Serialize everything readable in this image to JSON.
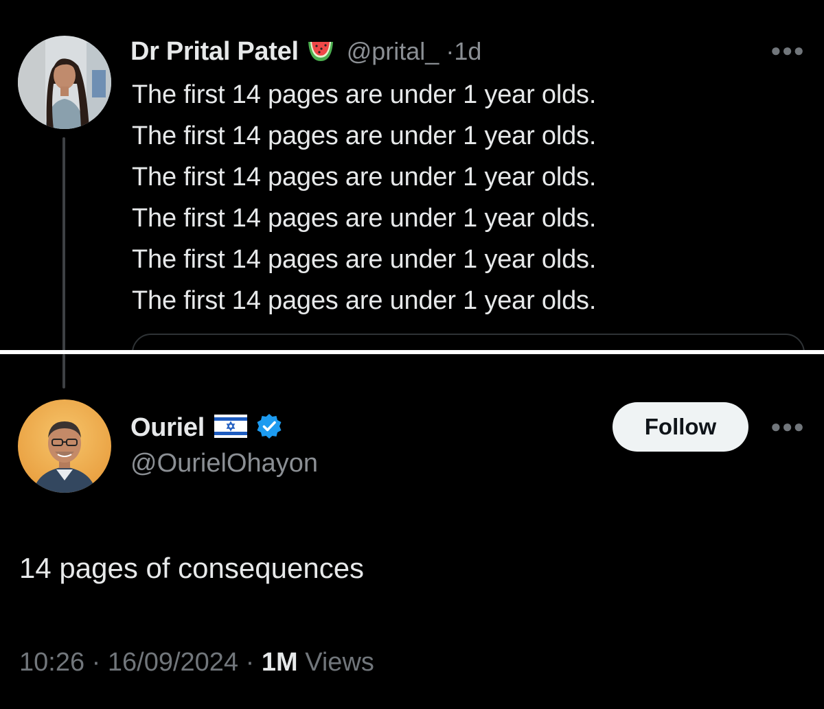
{
  "top_tweet": {
    "display_name": "Dr Prital Patel",
    "name_emoji": "watermelon-emoji",
    "handle": "@prital_",
    "separator": "·",
    "time_ago": "1d",
    "more_icon": "more-horizontal-icon",
    "lines": [
      "The first 14 pages are under 1 year olds.",
      "The first 14 pages are under 1 year olds.",
      "The first 14 pages are under 1 year olds.",
      "The first 14 pages are under 1 year olds.",
      "The first 14 pages are under 1 year olds.",
      "The first 14 pages are under 1 year olds."
    ]
  },
  "reply_tweet": {
    "display_name": "Ouriel",
    "name_flag": "israel-flag-emoji",
    "verified_badge": "verified-check-icon",
    "handle": "@OurielOhayon",
    "follow_label": "Follow",
    "more_icon": "more-horizontal-icon",
    "text": "14 pages of consequences",
    "time": "10:26",
    "date": "16/09/2024",
    "separator": "·",
    "views_count": "1M",
    "views_label": "Views"
  },
  "colors": {
    "background": "#000000",
    "primary_text": "#e7e9ea",
    "secondary_text": "#71767b",
    "verified_blue": "#1d9bf0",
    "follow_bg": "#eff3f4",
    "divider": "#ffffff"
  }
}
